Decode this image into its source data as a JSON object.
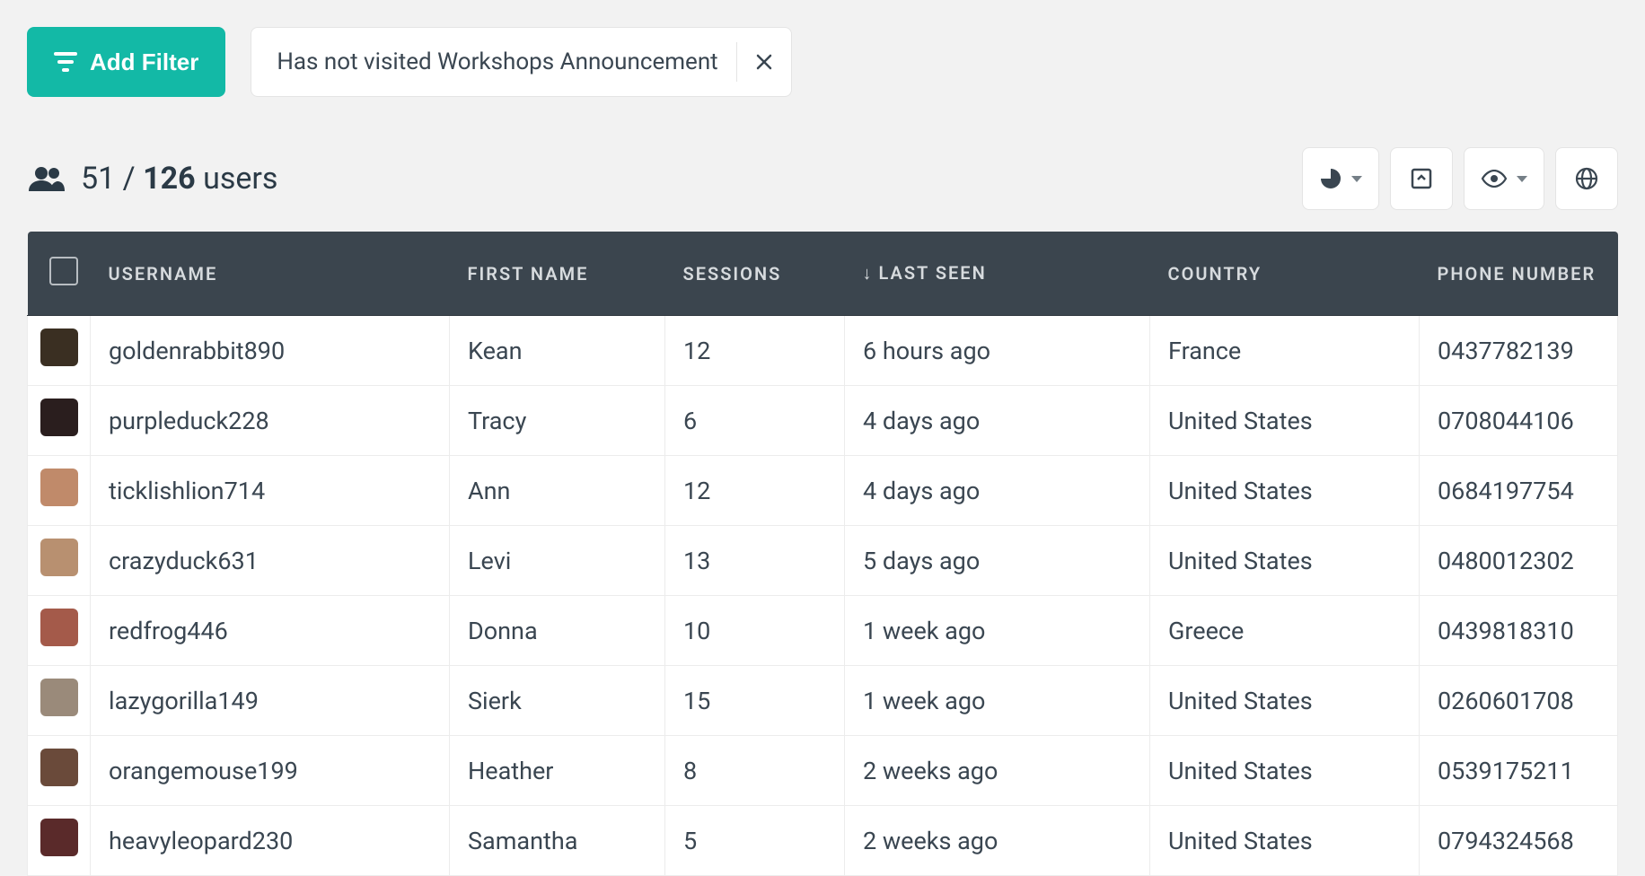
{
  "toolbar": {
    "add_filter_label": "Add Filter",
    "filter_chip_label": "Has not visited Workshops Announcement"
  },
  "summary": {
    "filtered_count": "51",
    "separator": "/",
    "total_count": "126",
    "users_word": "users"
  },
  "columns": {
    "username": "USERNAME",
    "first_name": "FIRST NAME",
    "sessions": "SESSIONS",
    "last_seen": "LAST SEEN",
    "country": "COUNTRY",
    "phone": "PHONE NUMBER",
    "sort_indicator": "↓"
  },
  "rows": [
    {
      "avatar_color": "#3a2f22",
      "username": "goldenrabbit890",
      "first_name": "Kean",
      "sessions": "12",
      "last_seen": "6 hours ago",
      "country": "France",
      "phone": "0437782139"
    },
    {
      "avatar_color": "#2a1e1e",
      "username": "purpleduck228",
      "first_name": "Tracy",
      "sessions": "6",
      "last_seen": "4 days ago",
      "country": "United States",
      "phone": "0708044106"
    },
    {
      "avatar_color": "#c08a6a",
      "username": "ticklishlion714",
      "first_name": "Ann",
      "sessions": "12",
      "last_seen": "4 days ago",
      "country": "United States",
      "phone": "0684197754"
    },
    {
      "avatar_color": "#b89070",
      "username": "crazyduck631",
      "first_name": "Levi",
      "sessions": "13",
      "last_seen": "5 days ago",
      "country": "United States",
      "phone": "0480012302"
    },
    {
      "avatar_color": "#a45a4a",
      "username": "redfrog446",
      "first_name": "Donna",
      "sessions": "10",
      "last_seen": "1 week ago",
      "country": "Greece",
      "phone": "0439818310"
    },
    {
      "avatar_color": "#9a8a7a",
      "username": "lazygorilla149",
      "first_name": "Sierk",
      "sessions": "15",
      "last_seen": "1 week ago",
      "country": "United States",
      "phone": "0260601708"
    },
    {
      "avatar_color": "#6a4a3a",
      "username": "orangemouse199",
      "first_name": "Heather",
      "sessions": "8",
      "last_seen": "2 weeks ago",
      "country": "United States",
      "phone": "0539175211"
    },
    {
      "avatar_color": "#5a2a2a",
      "username": "heavyleopard230",
      "first_name": "Samantha",
      "sessions": "5",
      "last_seen": "2 weeks ago",
      "country": "United States",
      "phone": "0794324568"
    }
  ]
}
